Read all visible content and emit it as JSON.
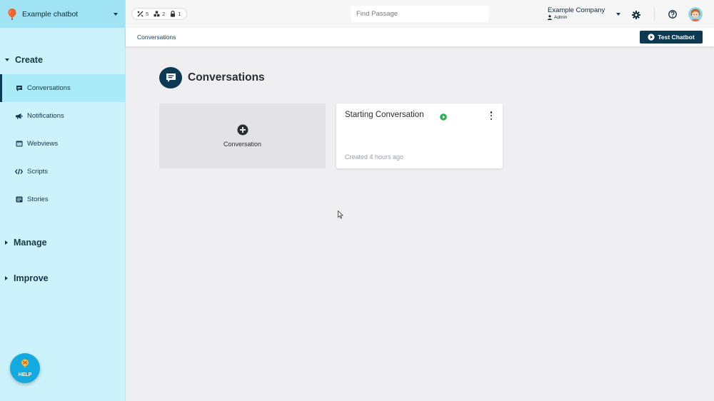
{
  "sidebar": {
    "bot_name": "Example chatbot",
    "sections": {
      "create": "Create",
      "manage": "Manage",
      "improve": "Improve"
    },
    "items": [
      {
        "label": "Conversations",
        "icon": "chat-icon",
        "active": true
      },
      {
        "label": "Notifications",
        "icon": "megaphone-icon",
        "active": false
      },
      {
        "label": "Webviews",
        "icon": "webview-icon",
        "active": false
      },
      {
        "label": "Scripts",
        "icon": "code-icon",
        "active": false
      },
      {
        "label": "Stories",
        "icon": "stories-icon",
        "active": false
      }
    ],
    "help_label": "HELP"
  },
  "topbar": {
    "stats": [
      {
        "icon": "tools-icon",
        "value": "5"
      },
      {
        "icon": "boxes-icon",
        "value": "2"
      },
      {
        "icon": "lock-icon",
        "value": "1"
      }
    ],
    "search_placeholder": "Find Passage",
    "company_name": "Example Company",
    "user_role": "Admin"
  },
  "subbar": {
    "breadcrumb": "Conversations",
    "test_button": "Test Chatbot"
  },
  "main": {
    "page_title": "Conversations",
    "new_card_label": "Conversation",
    "cards": [
      {
        "title": "Starting Conversation",
        "meta": "Created 4 hours ago",
        "status": "active"
      }
    ]
  },
  "colors": {
    "sidebar_bg": "#ccf2fb",
    "sidebar_active": "#a9ebf8",
    "primary_dark": "#0c3a52",
    "status_green": "#2bb24c",
    "help_blue": "#14a9df"
  }
}
